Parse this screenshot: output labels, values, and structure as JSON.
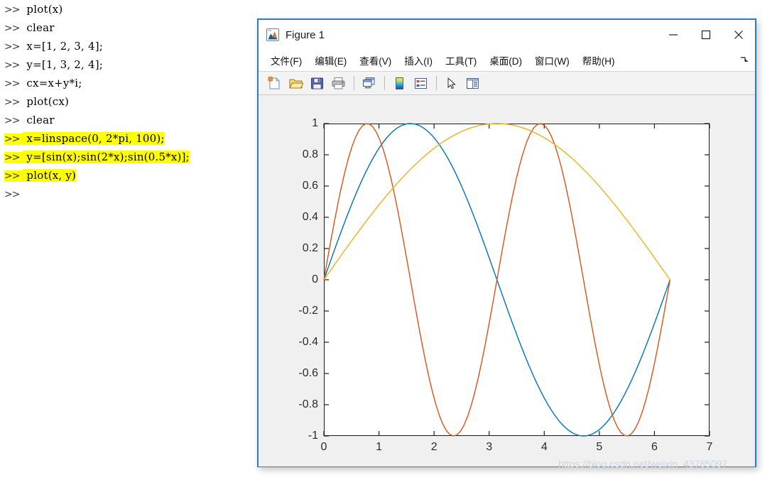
{
  "console": {
    "lines": [
      {
        "prompt": ">>",
        "code": " plot(x)",
        "highlighted": false
      },
      {
        "prompt": ">>",
        "code": " clear",
        "highlighted": false
      },
      {
        "prompt": ">>",
        "code": " x=[1, 2, 3, 4];",
        "highlighted": false
      },
      {
        "prompt": ">>",
        "code": " y=[1, 3, 2, 4];",
        "highlighted": false
      },
      {
        "prompt": ">>",
        "code": " cx=x+y*i;",
        "highlighted": false
      },
      {
        "prompt": ">>",
        "code": " plot(cx)",
        "highlighted": false
      },
      {
        "prompt": ">>",
        "code": " clear",
        "highlighted": false
      },
      {
        "prompt": ">>",
        "code": " x=linspace(0, 2*pi, 100);",
        "highlighted": true
      },
      {
        "prompt": ">>",
        "code": " y=[sin(x);sin(2*x);sin(0.5*x)];",
        "highlighted": true
      },
      {
        "prompt": ">>",
        "code": " plot(x, y)",
        "highlighted": true
      },
      {
        "prompt": ">>",
        "code": "",
        "highlighted": false
      }
    ],
    "highlight_color": "#ffff00"
  },
  "figure_window": {
    "title": "Figure 1",
    "app_icon": "matlab-membrane-icon",
    "window_buttons": [
      {
        "name": "minimize",
        "glyph": "minimize-icon"
      },
      {
        "name": "maximize",
        "glyph": "maximize-icon"
      },
      {
        "name": "close",
        "glyph": "close-icon"
      }
    ],
    "menu": [
      {
        "label": "文件(F)",
        "name": "file"
      },
      {
        "label": "编辑(E)",
        "name": "edit"
      },
      {
        "label": "查看(V)",
        "name": "view"
      },
      {
        "label": "插入(I)",
        "name": "insert"
      },
      {
        "label": "工具(T)",
        "name": "tools"
      },
      {
        "label": "桌面(D)",
        "name": "desktop"
      },
      {
        "label": "窗口(W)",
        "name": "window"
      },
      {
        "label": "帮助(H)",
        "name": "help"
      }
    ],
    "resize_grip": "resize-grip-icon",
    "toolbar": [
      {
        "name": "new-figure-icon",
        "type": "button"
      },
      {
        "name": "open-file-icon",
        "type": "button"
      },
      {
        "name": "save-figure-icon",
        "type": "button"
      },
      {
        "name": "print-figure-icon",
        "type": "button"
      },
      {
        "name": "separator",
        "type": "separator"
      },
      {
        "name": "link-plot-icon",
        "type": "button"
      },
      {
        "name": "separator",
        "type": "separator"
      },
      {
        "name": "insert-colorbar-icon",
        "type": "button"
      },
      {
        "name": "insert-legend-icon",
        "type": "button"
      },
      {
        "name": "separator",
        "type": "separator"
      },
      {
        "name": "edit-pointer-icon",
        "type": "button"
      },
      {
        "name": "show-plot-tools-icon",
        "type": "button"
      }
    ],
    "border_color": "#2a7ad0",
    "canvas_color": "#f0f0f0"
  },
  "chart_data": {
    "type": "line",
    "title": "",
    "xlabel": "",
    "ylabel": "",
    "xlim": [
      0,
      7
    ],
    "ylim": [
      -1,
      1
    ],
    "xticks": [
      0,
      1,
      2,
      3,
      4,
      5,
      6,
      7
    ],
    "yticks": [
      1,
      0.8,
      0.6,
      0.4,
      0.2,
      0,
      -0.2,
      -0.4,
      -0.6,
      -0.8,
      -1
    ],
    "xtick_labels": [
      "0",
      "1",
      "2",
      "3",
      "4",
      "5",
      "6",
      "7"
    ],
    "ytick_labels": [
      "1",
      "0.8",
      "0.6",
      "0.4",
      "0.2",
      "0",
      "-0.2",
      "-0.4",
      "-0.6",
      "-0.8",
      "-1"
    ],
    "grid": false,
    "legend": null,
    "x_domain": [
      0,
      6.283185307179586
    ],
    "n_points": 100,
    "series": [
      {
        "name": "sin(x)",
        "color": "#0072BD",
        "fn": "sin",
        "freq": 1
      },
      {
        "name": "sin(2*x)",
        "color": "#D95319",
        "fn": "sin",
        "freq": 2
      },
      {
        "name": "sin(0.5*x)",
        "color": "#EDB120",
        "fn": "sin",
        "freq": 0.5
      }
    ]
  },
  "watermark": {
    "text": "https://blog.csdn.net/weixin_43785097"
  }
}
